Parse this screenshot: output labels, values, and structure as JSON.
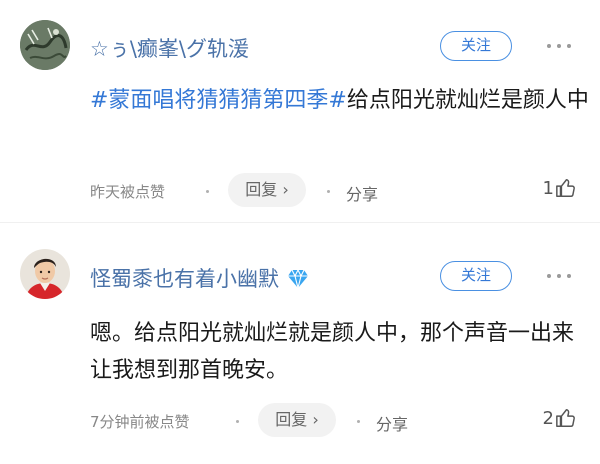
{
  "comments": [
    {
      "username": "☆ぅ\\癫峯\\グ轨湲",
      "follow_label": "关注",
      "hashtag": "#蒙面唱将猜猜猜第四季#",
      "content_rest": "给点阳光就灿烂是颜人中",
      "liked_text": "昨天被点赞",
      "reply_label": "回复 ›",
      "share_label": "分享",
      "like_count": "1"
    },
    {
      "username": "怪蜀黍也有着小幽默",
      "verified_icon": "diamond-icon",
      "follow_label": "关注",
      "content": "嗯。给点阳光就灿烂就是颜人中，那个声音一出来让我想到那首晚安。",
      "liked_text": "7分钟前被点赞",
      "reply_label": "回复 ›",
      "share_label": "分享",
      "like_count": "2"
    }
  ],
  "colors": {
    "username": "#4a72a8",
    "hashtag": "#3478d6",
    "follow_border": "#4a90e2",
    "verified_diamond": "#3aa6f0"
  }
}
